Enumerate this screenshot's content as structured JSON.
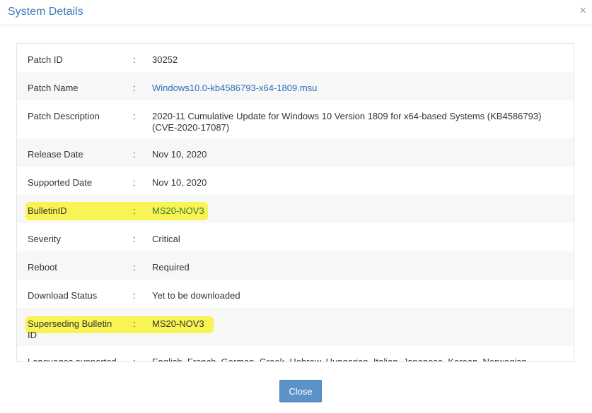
{
  "dialog": {
    "title": "System Details",
    "close_icon": "×",
    "close_button_label": "Close"
  },
  "details": [
    {
      "label": "Patch ID",
      "value": "30252"
    },
    {
      "label": "Patch Name",
      "value": "Windows10.0-kb4586793-x64-1809.msu"
    },
    {
      "label": "Patch Description",
      "value": "2020-11 Cumulative Update for Windows 10 Version 1809 for x64-based Systems (KB4586793) (CVE-2020-17087)"
    },
    {
      "label": "Release Date",
      "value": "Nov 10, 2020"
    },
    {
      "label": "Supported Date",
      "value": "Nov 10, 2020"
    },
    {
      "label": "BulletinID",
      "value": "MS20-NOV3"
    },
    {
      "label": "Severity",
      "value": "Critical"
    },
    {
      "label": "Reboot",
      "value": "Required"
    },
    {
      "label": "Download Status",
      "value": "Yet to be downloaded"
    },
    {
      "label": "Superseding Bulletin ID",
      "value": "MS20-NOV3"
    },
    {
      "label": "Languages supported",
      "value": "English, French, German, Greek, Hebrew, Hungarian, Italian, Japanese, Korean, Norwegian (Bokmål)"
    }
  ],
  "separator": ":",
  "colors": {
    "title": "#3d7ab8",
    "link": "#2a6ebb",
    "highlight": "#f8f34a",
    "button": "#5b93c9"
  }
}
